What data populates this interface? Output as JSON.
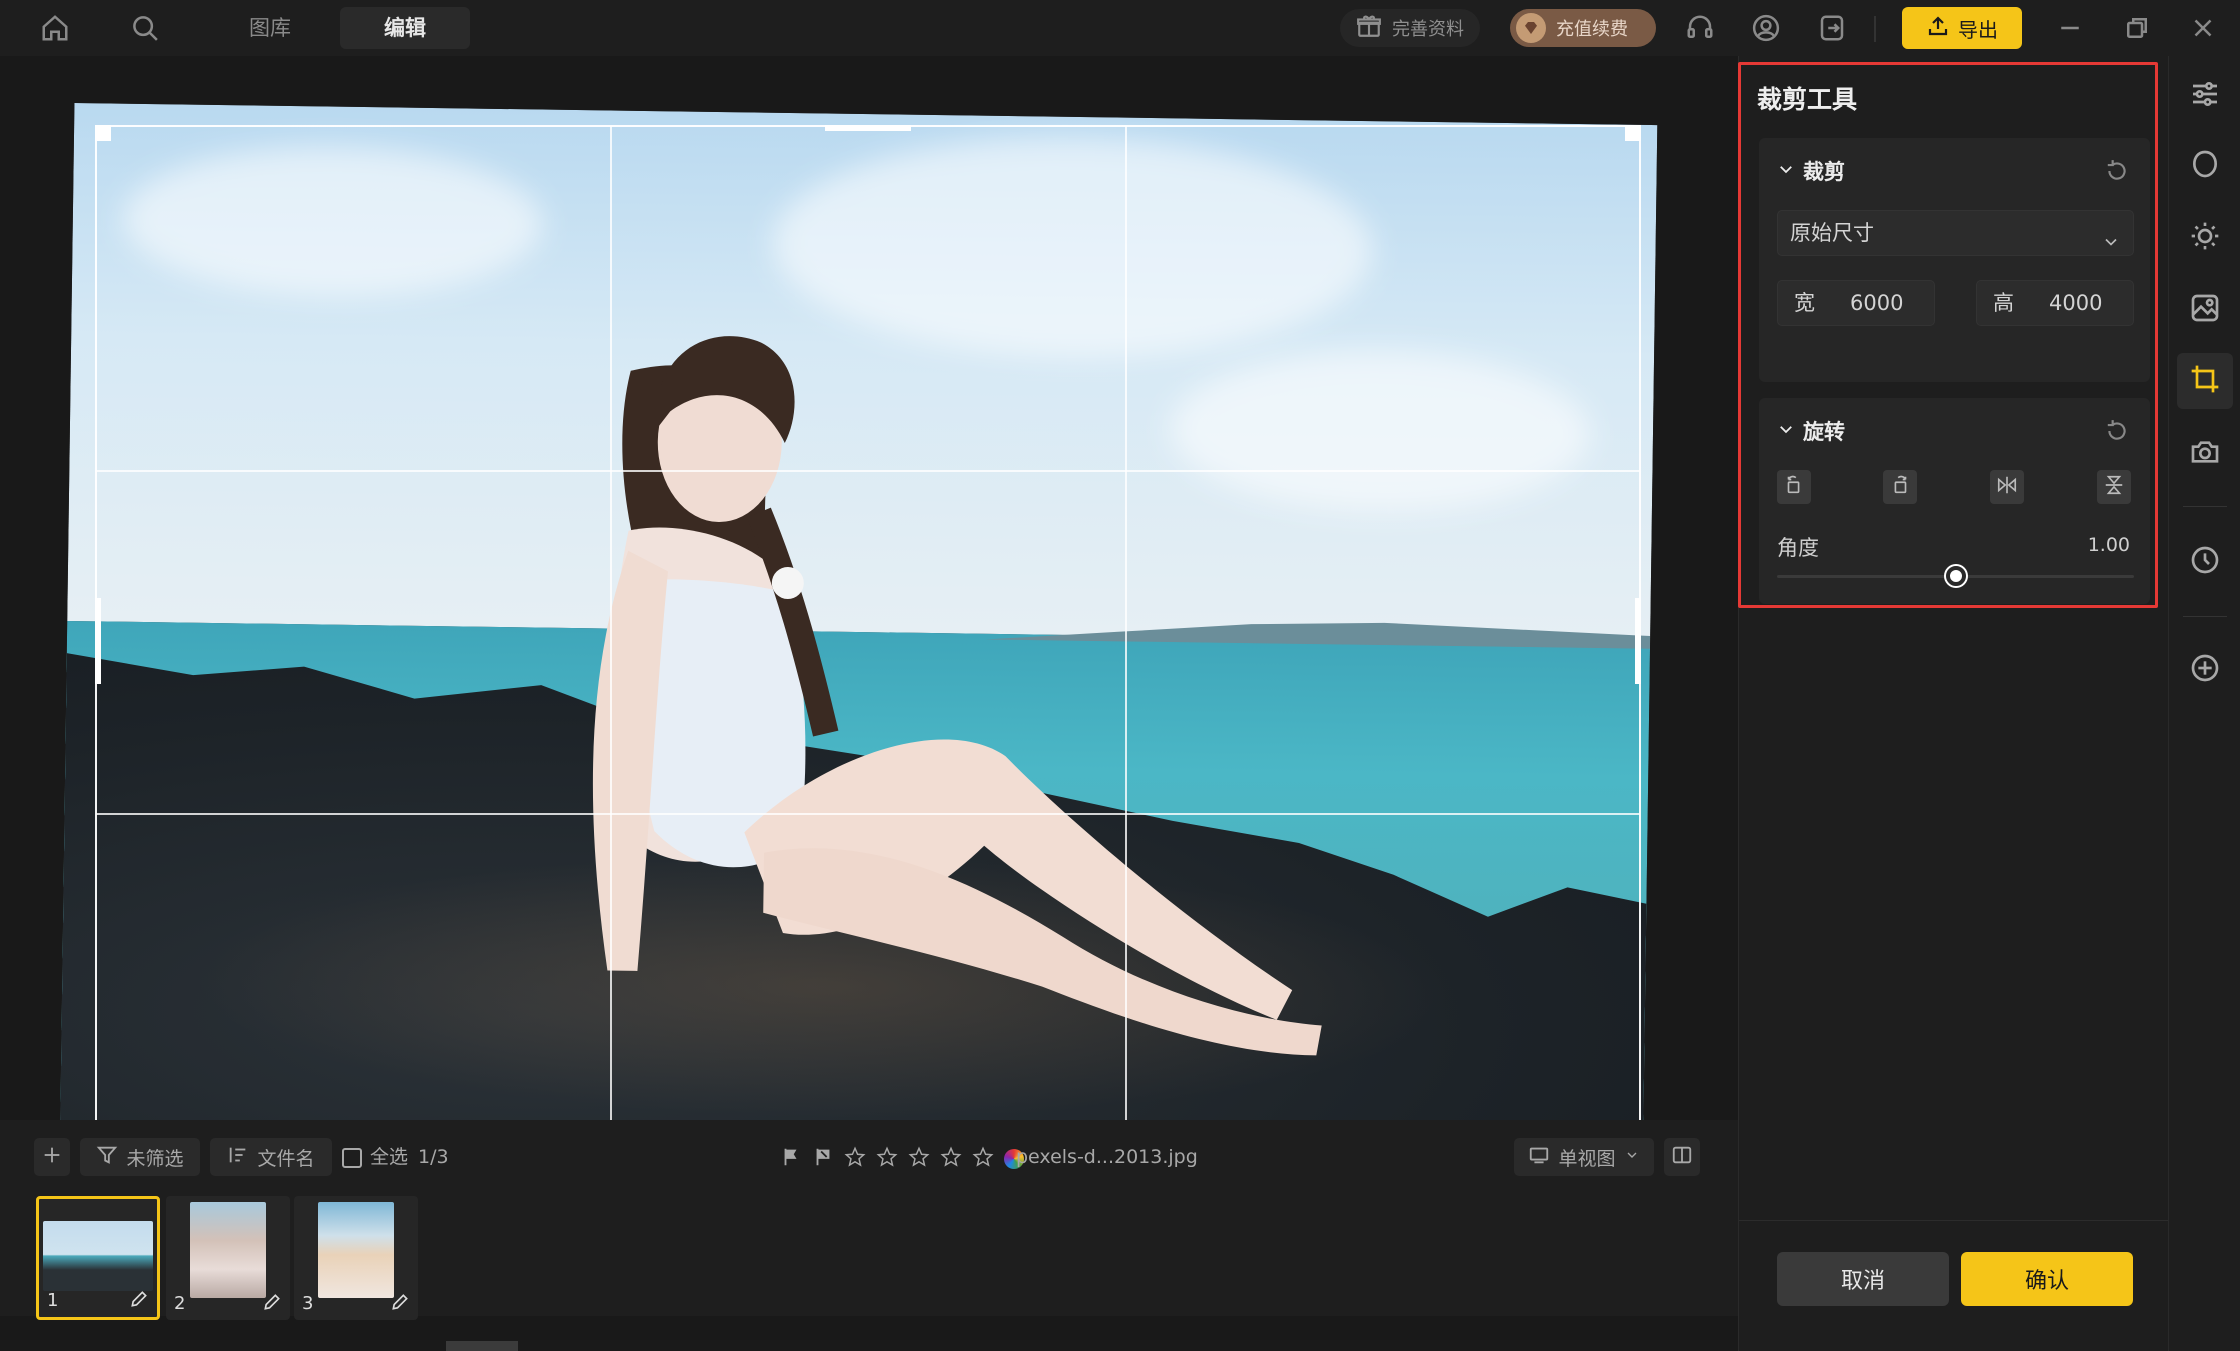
{
  "topbar": {
    "tabs": [
      {
        "label": "图库",
        "active": false
      },
      {
        "label": "编辑",
        "active": true
      }
    ],
    "profile_label": "完善资料",
    "vip_label": "充值续费",
    "export_label": "导出"
  },
  "crop_tool": {
    "title": "裁剪工具",
    "crop_section": {
      "label": "裁剪",
      "ratio_selected": "原始尺寸",
      "width_label": "宽",
      "width_value": "6000",
      "height_label": "高",
      "height_value": "4000"
    },
    "rotate_section": {
      "label": "旋转",
      "angle_label": "角度",
      "angle_value": "1.00",
      "angle_position": 0.5
    },
    "cancel_label": "取消",
    "confirm_label": "确认"
  },
  "bottombar": {
    "filter_label": "未筛选",
    "sort_label": "文件名",
    "select_all_label": "全选",
    "selection_count": "1/3",
    "filename": "pexels-d...2013.jpg",
    "view_mode_label": "单视图"
  },
  "filmstrip": [
    {
      "number": "1",
      "selected": true
    },
    {
      "number": "2",
      "selected": false
    },
    {
      "number": "3",
      "selected": false
    }
  ],
  "colors": {
    "accent": "#f5c518",
    "highlight_border": "#e53935",
    "background": "#191919",
    "panel": "#1e1e1e"
  },
  "icons": [
    "home-icon",
    "search-icon",
    "gift-icon",
    "vip-gem-icon",
    "headset-icon",
    "user-icon",
    "logout-icon",
    "upload-icon",
    "minimize-icon",
    "restore-icon",
    "close-icon",
    "sliders-icon",
    "circle-icon",
    "sun-icon",
    "image-adjust-icon",
    "crop-icon",
    "camera-icon",
    "history-icon",
    "plus-circle-icon"
  ]
}
